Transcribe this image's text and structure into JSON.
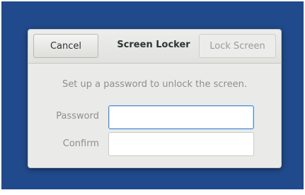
{
  "dialog": {
    "title": "Screen Locker",
    "cancel_label": "Cancel",
    "lock_label": "Lock Screen",
    "prompt": "Set up a password to unlock the screen.",
    "fields": [
      {
        "label": "Password",
        "value": ""
      },
      {
        "label": "Confirm",
        "value": ""
      }
    ]
  },
  "colors": {
    "desktop_background": "#214a8c",
    "focus_accent": "#4a90d9"
  }
}
